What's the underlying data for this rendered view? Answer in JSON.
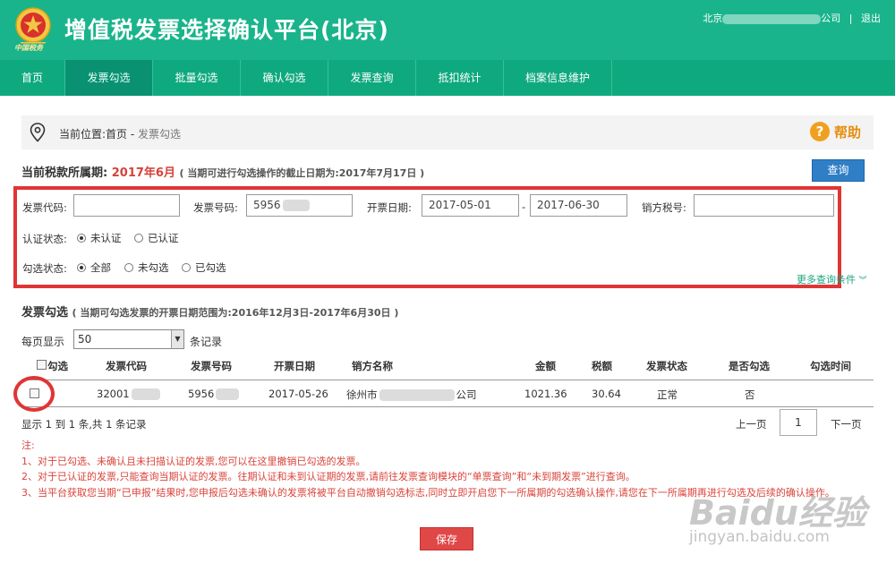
{
  "header": {
    "title": "增值税发票选择确认平台(北京)",
    "emblem_text": "中国税务",
    "user_prefix": "北京",
    "user_suffix": "公司",
    "separator": "|",
    "logout": "退出"
  },
  "nav": {
    "items": [
      "首页",
      "发票勾选",
      "批量勾选",
      "确认勾选",
      "发票查询",
      "抵扣统计",
      "档案信息维护"
    ],
    "active": "发票勾选"
  },
  "breadcrumb": {
    "label": "当前位置:首页 -",
    "current": "发票勾选",
    "help": "帮助"
  },
  "period": {
    "label": "当前税款所属期:",
    "value": "2017年6月",
    "note": "( 当期可进行勾选操作的截止日期为:2017年7月17日 )",
    "query_button": "查询"
  },
  "filters": {
    "invoice_code_label": "发票代码:",
    "invoice_code_value": "",
    "invoice_number_label": "发票号码:",
    "invoice_number_value": "5956",
    "date_label": "开票日期:",
    "date_from": "2017-05-01",
    "date_separator": "-",
    "date_to": "2017-06-30",
    "seller_tax_label": "销方税号:",
    "seller_tax_value": "",
    "auth_status_label": "认证状态:",
    "auth_options": [
      "未认证",
      "已认证"
    ],
    "auth_selected": 0,
    "check_status_label": "勾选状态:",
    "check_options": [
      "全部",
      "未勾选",
      "已勾选"
    ],
    "check_selected": 0,
    "more_link": "更多查询条件"
  },
  "section": {
    "title": "发票勾选",
    "note": "( 当期可勾选发票的开票日期范围为:2016年12月3日-2017年6月30日 )",
    "per_page_label": "每页显示",
    "per_page_value": "50",
    "per_page_suffix": "条记录"
  },
  "table": {
    "headers": [
      "勾选",
      "发票代码",
      "发票号码",
      "开票日期",
      "销方名称",
      "金额",
      "税额",
      "发票状态",
      "是否勾选",
      "勾选时间"
    ],
    "rows": [
      {
        "code_prefix": "32001",
        "number_prefix": "5956",
        "date": "2017-05-26",
        "seller_prefix": "徐州市",
        "seller_suffix": "公司",
        "amount": "1021.36",
        "tax": "30.64",
        "status": "正常",
        "checked": "否",
        "check_time": ""
      }
    ],
    "summary": "显示 1 到 1 条,共 1 条记录",
    "prev": "上一页",
    "page": "1",
    "next": "下一页"
  },
  "notes": {
    "title": "注:",
    "items": [
      "1、对于已勾选、未确认且未扫描认证的发票,您可以在这里撤销已勾选的发票。",
      "2、对于已认证的发票,只能查询当期认证的发票。往期认证和未到认证期的发票,请前往发票查询模块的“单票查询”和“未到期发票”进行查询。",
      "3、当平台获取您当期“已申报”结果时,您申报后勾选未确认的发票将被平台自动撤销勾选标志,同时立即开启您下一所属期的勾选确认操作,请您在下一所属期再进行勾选及后续的确认操作。"
    ]
  },
  "save_button": "保存",
  "watermark": {
    "main": "Baidu经验",
    "sub": "jingyan.baidu.com"
  },
  "colors": {
    "header": "#19b48b",
    "nav": "#0fa97f",
    "nav_active": "#099172",
    "accent_red": "#d6423a",
    "highlight": "#e03535",
    "query_button": "#2f7fc6"
  }
}
